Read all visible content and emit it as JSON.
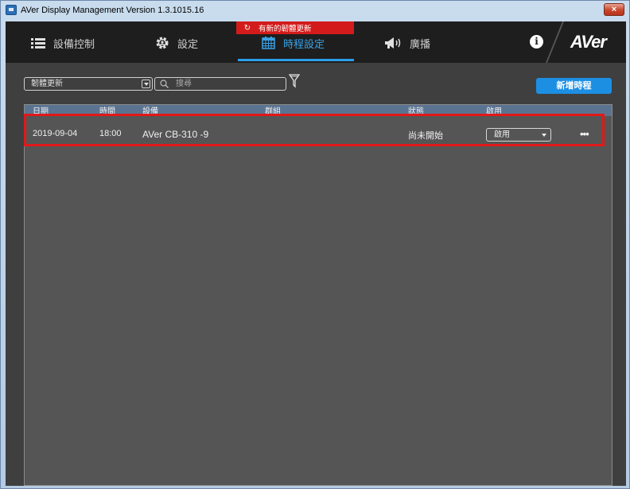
{
  "window": {
    "title": "AVer Display Management Version 1.3.1015.16",
    "close_label": "×"
  },
  "nav": {
    "items": [
      {
        "label": "設備控制",
        "icon": "list-icon"
      },
      {
        "label": "設定",
        "icon": "gear-icon"
      },
      {
        "label": "時程設定",
        "icon": "calendar-icon",
        "active": true
      },
      {
        "label": "廣播",
        "icon": "megaphone-icon"
      }
    ],
    "update_badge": "有新的韌體更新",
    "info_label": "i",
    "brand": "AVer",
    "active_color": "#2b9ee9"
  },
  "toolbar": {
    "type_select": "韌體更新",
    "search_placeholder": "搜尋",
    "add_button": "新增時程"
  },
  "table": {
    "columns": [
      "日期",
      "時間",
      "設備",
      "群組",
      "狀態",
      "啟用"
    ],
    "rows": [
      {
        "date": "2019-09-04",
        "time": "18:00",
        "device": "AVer CB-310 -9",
        "group": "",
        "status": "尚未開始",
        "enable": "啟用",
        "more": "•••"
      }
    ]
  },
  "colors": {
    "highlight": "#e21818",
    "button": "#1c8fe3",
    "header": "#5a7391"
  }
}
